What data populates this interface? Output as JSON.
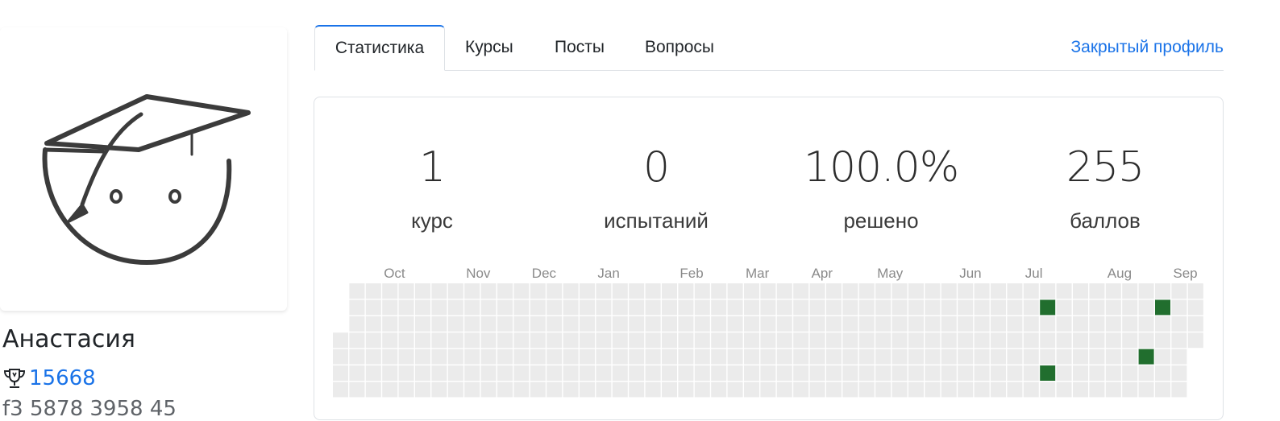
{
  "profile": {
    "name": "Анастасия",
    "score": "15668",
    "clipped_id": "f3 5878 3958 45"
  },
  "tabs": [
    {
      "label": "Статистика",
      "active": true
    },
    {
      "label": "Курсы",
      "active": false
    },
    {
      "label": "Посты",
      "active": false
    },
    {
      "label": "Вопросы",
      "active": false
    }
  ],
  "private_profile_link": "Закрытый профиль",
  "stats": [
    {
      "value": "1",
      "label": "курс"
    },
    {
      "value": "0",
      "label": "испытаний"
    },
    {
      "value": "100.0%",
      "label": "решено"
    },
    {
      "value": "255",
      "label": "баллов"
    }
  ],
  "colors": {
    "accent": "#1a73e8",
    "cell_empty": "#ebebeb",
    "cell_active": "#216e2e"
  },
  "activity": {
    "months": [
      "Oct",
      "Nov",
      "Dec",
      "Jan",
      "Feb",
      "Mar",
      "Apr",
      "May",
      "Jun",
      "Jul",
      "Aug",
      "Sep"
    ],
    "active_cells": [
      {
        "week": 43,
        "day": 1
      },
      {
        "week": 43,
        "day": 5
      },
      {
        "week": 49,
        "day": 4
      },
      {
        "week": 50,
        "day": 1
      }
    ]
  }
}
